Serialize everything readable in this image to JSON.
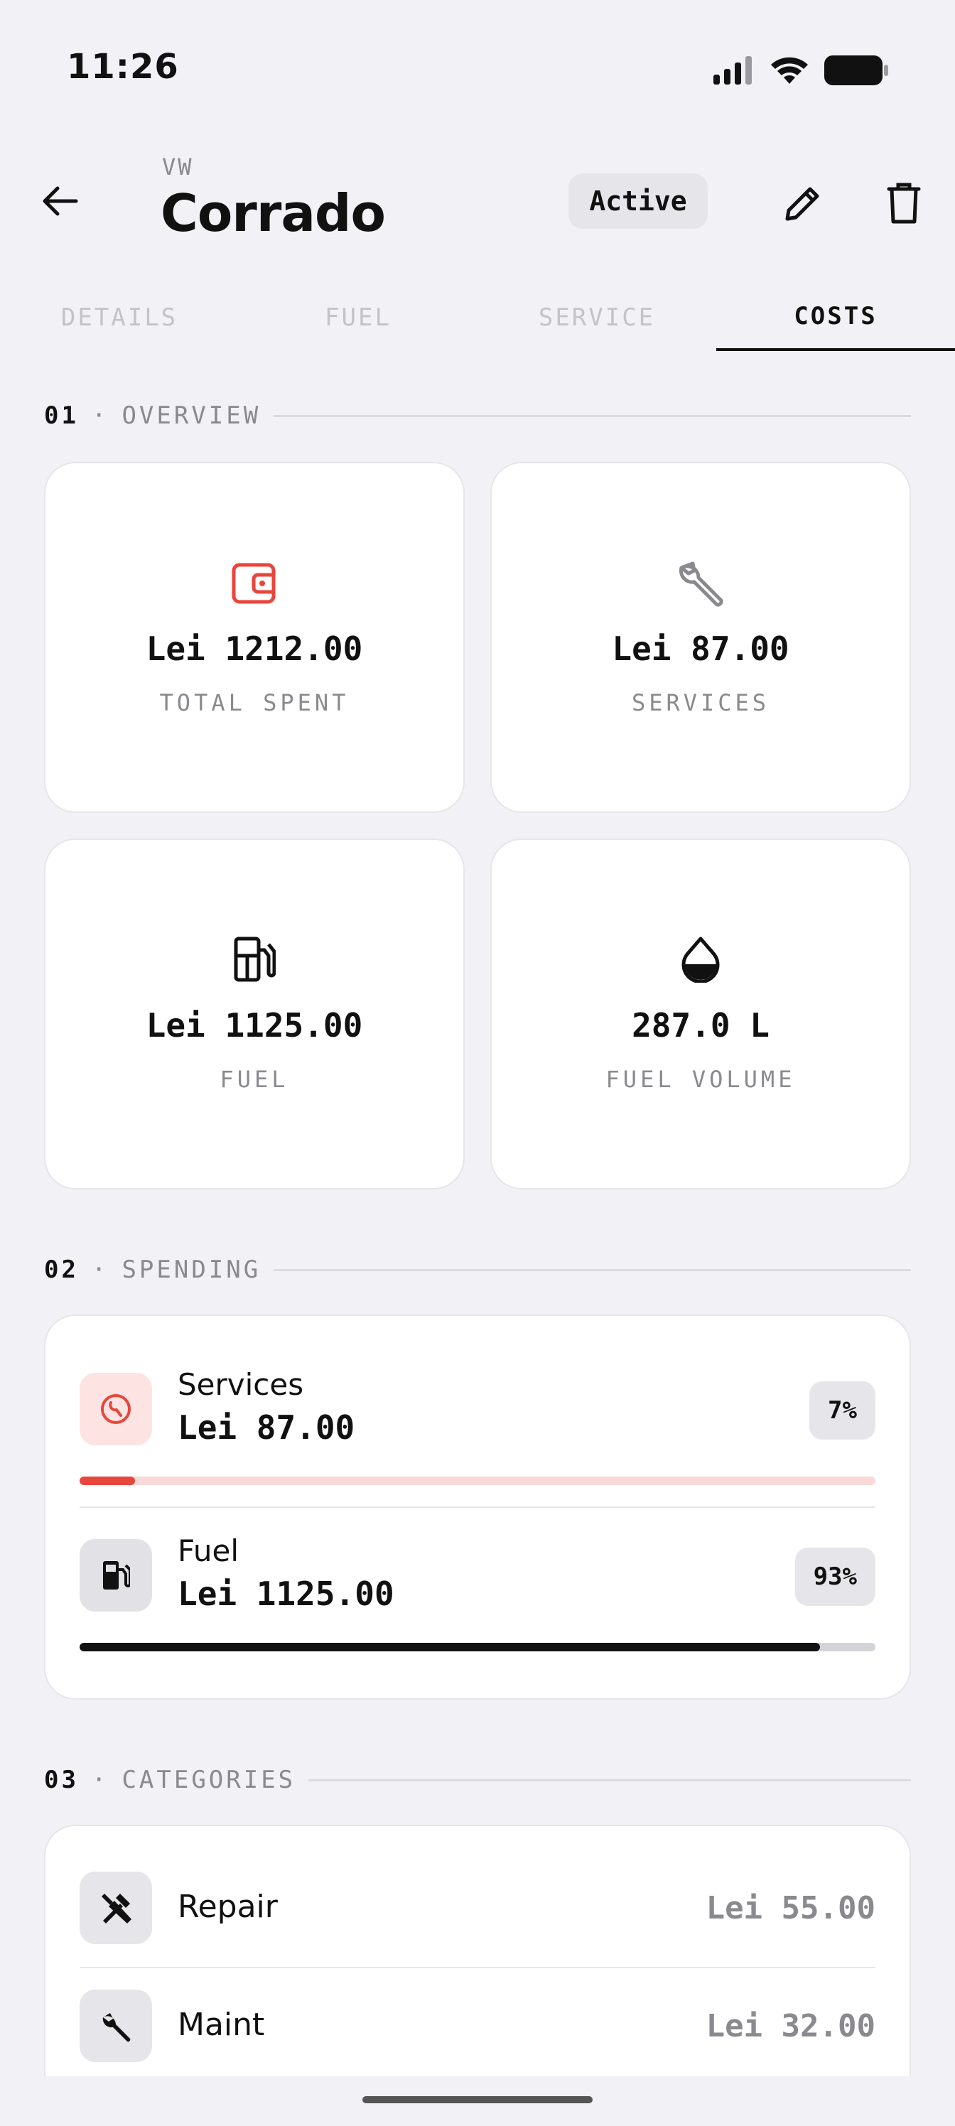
{
  "status_bar": {
    "time": "11:26"
  },
  "header": {
    "make": "VW",
    "model": "Corrado",
    "status": "Active"
  },
  "tabs": [
    {
      "label": "DETAILS"
    },
    {
      "label": "FUEL"
    },
    {
      "label": "SERVICE"
    },
    {
      "label": "COSTS"
    }
  ],
  "overview": {
    "number": "01",
    "separator": "·",
    "title": "OVERVIEW",
    "cards": [
      {
        "value": "Lei 1212.00",
        "label": "TOTAL SPENT",
        "icon": "wallet-icon",
        "color": "#e8463c"
      },
      {
        "value": "Lei 87.00",
        "label": "SERVICES",
        "icon": "wrench-icon",
        "color": "#8a8a8e"
      },
      {
        "value": "Lei 1125.00",
        "label": "FUEL",
        "icon": "fuel-pump-icon",
        "color": "#111111"
      },
      {
        "value": "287.0 L",
        "label": "FUEL VOLUME",
        "icon": "drop-icon",
        "color": "#111111"
      }
    ]
  },
  "spending": {
    "number": "02",
    "separator": "·",
    "title": "SPENDING",
    "items": [
      {
        "name": "Services",
        "amount": "Lei 87.00",
        "percent": "7%",
        "fraction": 0.07,
        "icon": "service-icon",
        "bar_color": "#e8463c",
        "track_color": "#f9d9d7",
        "tile_color": "#fde4e2"
      },
      {
        "name": "Fuel",
        "amount": "Lei 1125.00",
        "percent": "93%",
        "fraction": 0.93,
        "icon": "fuel-pump-icon",
        "bar_color": "#111111",
        "track_color": "#d4d4d8",
        "tile_color": "#e2e2e6"
      }
    ]
  },
  "categories": {
    "number": "03",
    "separator": "·",
    "title": "CATEGORIES",
    "items": [
      {
        "name": "Repair",
        "amount": "Lei 55.00",
        "icon": "hammer-wrench-icon"
      },
      {
        "name": "Maint",
        "amount": "Lei 32.00",
        "icon": "wrench-icon"
      }
    ]
  }
}
